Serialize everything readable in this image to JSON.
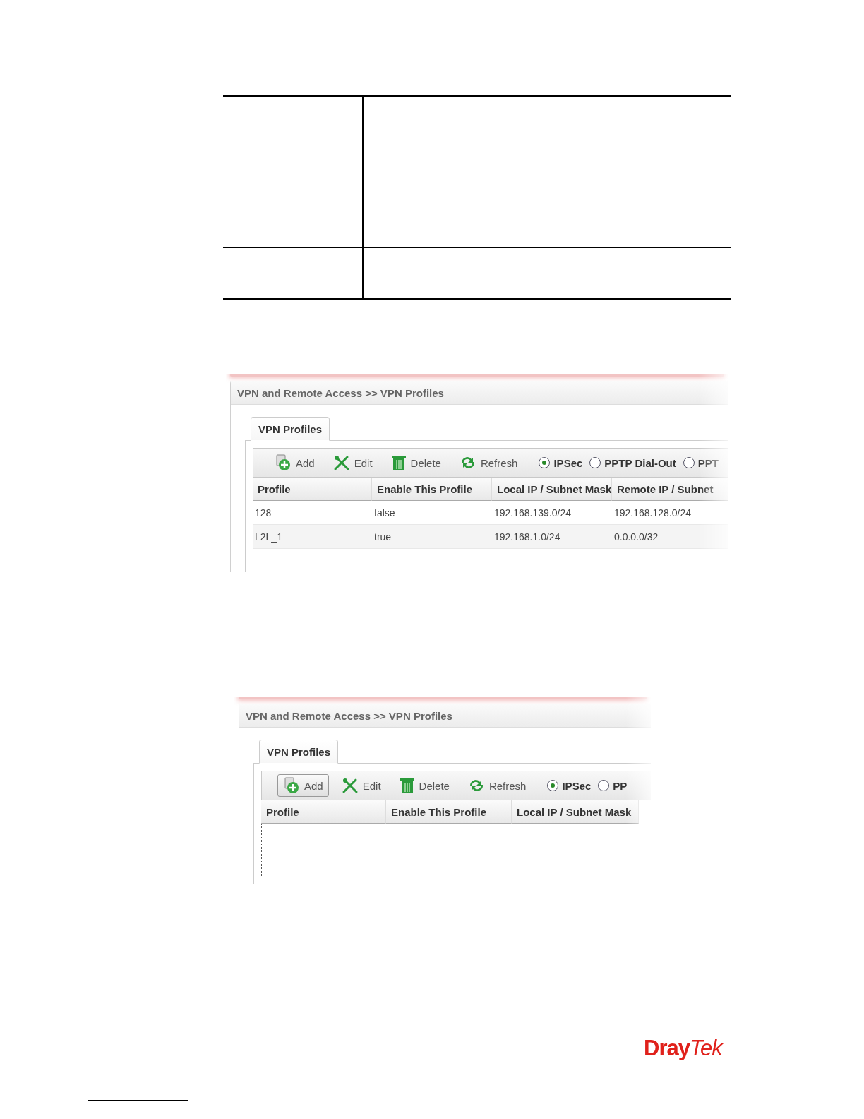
{
  "screenshots": [
    {
      "breadcrumb": "VPN and Remote Access >> VPN Profiles",
      "tab": {
        "label": "VPN Profiles",
        "selected": true
      },
      "toolbar": [
        {
          "kind": "add",
          "label": "Add",
          "pressed": false
        },
        {
          "kind": "edit",
          "label": "Edit",
          "pressed": false
        },
        {
          "kind": "delete",
          "label": "Delete",
          "pressed": false
        },
        {
          "kind": "refresh",
          "label": "Refresh",
          "pressed": false
        }
      ],
      "radios": [
        {
          "label": "IPSec",
          "selected": true
        },
        {
          "label": "PPTP Dial-Out",
          "selected": false
        },
        {
          "label": "PPT",
          "selected": false
        }
      ],
      "columns": [
        "Profile",
        "Enable This Profile",
        "Local IP / Subnet Mask",
        "Remote IP / Subnet"
      ],
      "rows": [
        [
          "128",
          "false",
          "192.168.139.0/24",
          "192.168.128.0/24"
        ],
        [
          "L2L_1",
          "true",
          "192.168.1.0/24",
          "0.0.0.0/32"
        ]
      ]
    },
    {
      "breadcrumb": "VPN and Remote Access >> VPN Profiles",
      "tab": {
        "label": "VPN Profiles",
        "selected": true
      },
      "toolbar": [
        {
          "kind": "add",
          "label": "Add",
          "pressed": true
        },
        {
          "kind": "edit",
          "label": "Edit",
          "pressed": false
        },
        {
          "kind": "delete",
          "label": "Delete",
          "pressed": false
        },
        {
          "kind": "refresh",
          "label": "Refresh",
          "pressed": false
        }
      ],
      "radios": [
        {
          "label": "IPSec",
          "selected": true
        },
        {
          "label": "PP",
          "selected": false
        }
      ],
      "columns": [
        "Profile",
        "Enable This Profile",
        "Local IP / Subnet Mask"
      ]
    }
  ],
  "logo": {
    "text_1": "Dray",
    "text_2": "Tek"
  }
}
